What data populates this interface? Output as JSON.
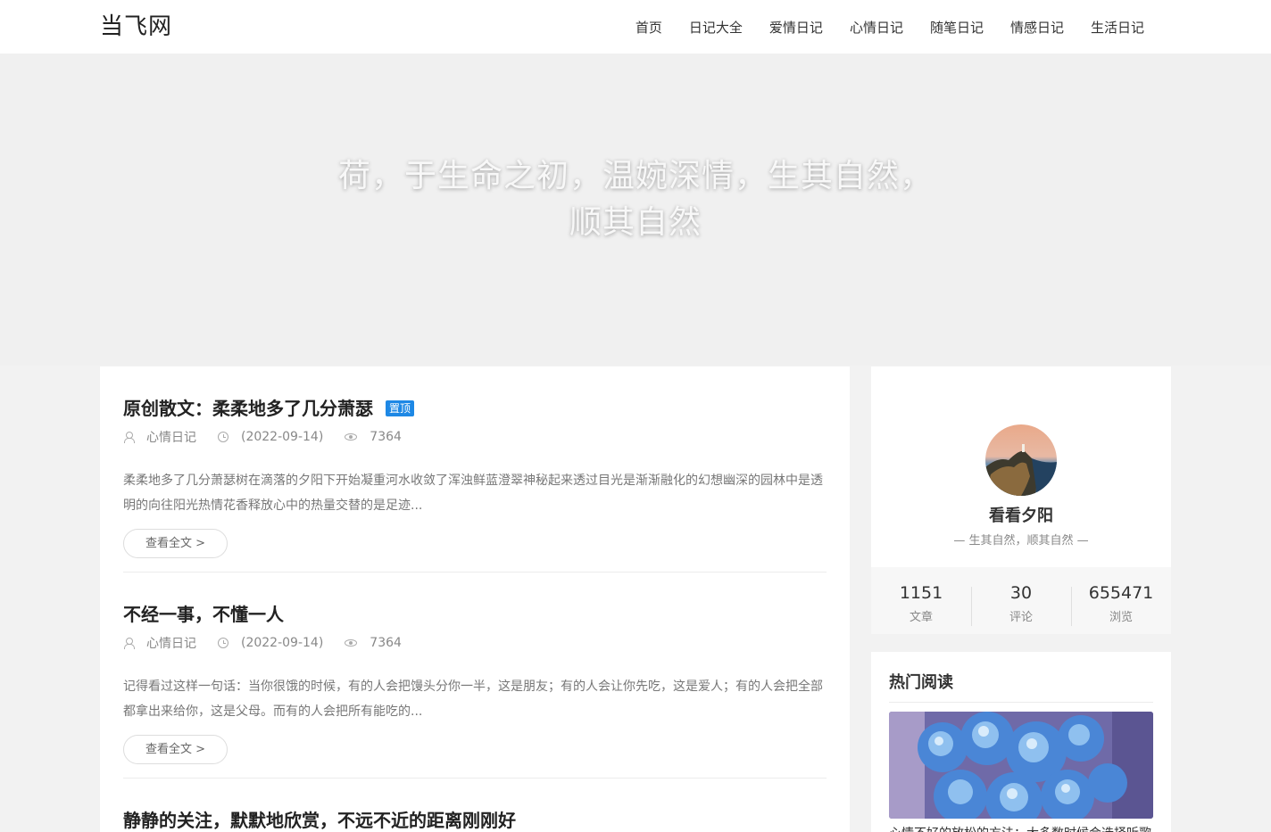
{
  "header": {
    "logo": "当飞网",
    "nav": [
      "首页",
      "日记大全",
      "爱情日记",
      "心情日记",
      "随笔日记",
      "情感日记",
      "生活日记"
    ]
  },
  "hero": {
    "title": "荷，于生命之初，温婉深情，生其自然，顺其自然"
  },
  "articles": [
    {
      "title": "原创散文：柔柔地多了几分萧瑟",
      "badge": "置顶",
      "category": "心情日记",
      "date": "(2022-09-14)",
      "views": "7364",
      "excerpt": "柔柔地多了几分萧瑟树在滴落的夕阳下开始凝重河水收敛了浑浊鲜蓝澄翠神秘起来透过目光是渐渐融化的幻想幽深的园林中是透明的向往阳光热情花香释放心中的热量交替的是足迹...",
      "read_more": "查看全文 >"
    },
    {
      "title": "不经一事，不懂一人",
      "category": "心情日记",
      "date": "(2022-09-14)",
      "views": "7364",
      "excerpt": "记得看过这样一句话：当你很饿的时候，有的人会把馒头分你一半，这是朋友；有的人会让你先吃，这是爱人；有的人会把全部都拿出来给你，这是父母。而有的人会把所有能吃的...",
      "read_more": "查看全文 >"
    },
    {
      "title": "静静的关注，默默地欣赏，不远不近的距离刚刚好"
    }
  ],
  "profile": {
    "name": "看看夕阳",
    "motto": "— 生其自然，顺其自然 —",
    "stats": [
      {
        "num": "1151",
        "label": "文章"
      },
      {
        "num": "30",
        "label": "评论"
      },
      {
        "num": "655471",
        "label": "浏览"
      }
    ]
  },
  "hot": {
    "title": "热门阅读",
    "caption": "心情不好的放松的方法：大多数时候会选择听歌"
  },
  "colors": {
    "accent": "#1e88e5",
    "background": "#f2f2f2"
  }
}
